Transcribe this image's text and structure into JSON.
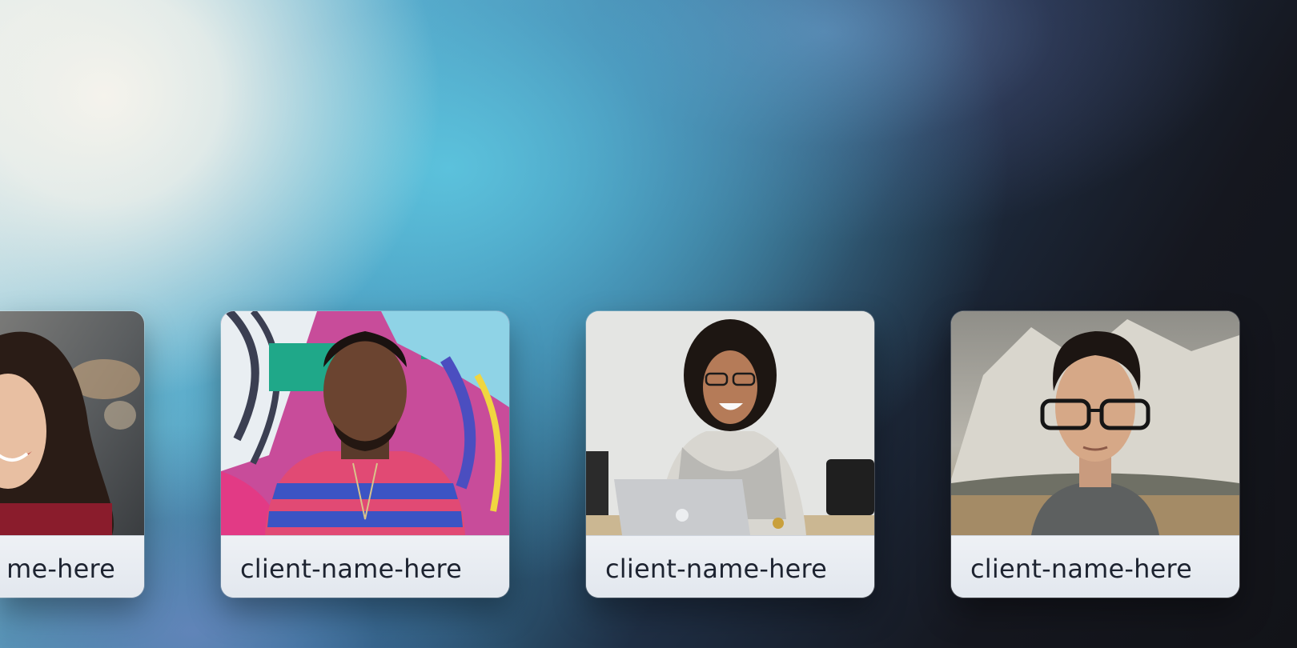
{
  "gallery": {
    "cards": [
      {
        "name": "me-here",
        "photo": "smiling-woman-dark-hair-photo"
      },
      {
        "name": "client-name-here",
        "photo": "man-graffiti-wall-photo"
      },
      {
        "name": "client-name-here",
        "photo": "woman-laptop-laughing-photo"
      },
      {
        "name": "client-name-here",
        "photo": "man-glasses-mountain-photo"
      }
    ]
  },
  "colors": {
    "caption_bg": "#e8ecf1",
    "caption_text": "#1d2330",
    "background_light": "#f5f3ec",
    "background_cyan": "#5cc4de",
    "background_dark": "#121318"
  }
}
